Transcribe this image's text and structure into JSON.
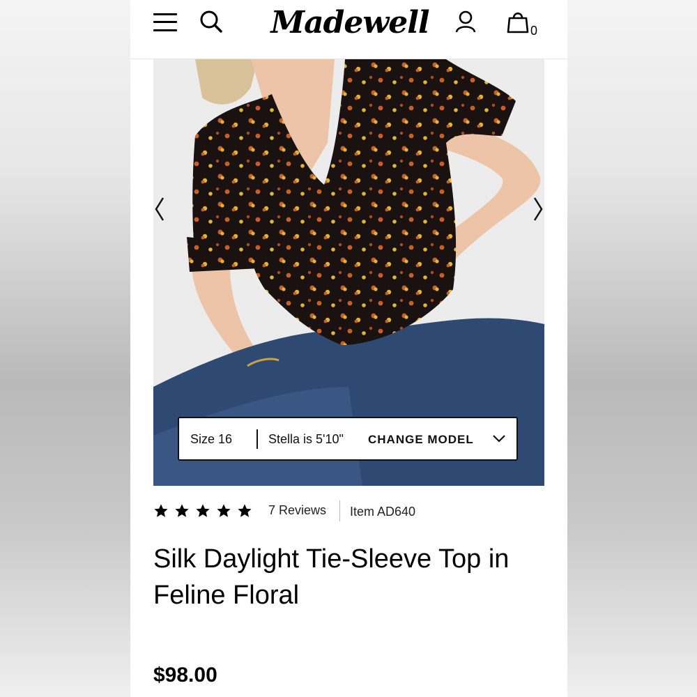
{
  "header": {
    "brand": "Madewell",
    "bag_count": "0"
  },
  "icons": [
    "menu-icon",
    "search-icon",
    "account-icon",
    "bag-icon",
    "chevron-left-icon",
    "chevron-right-icon",
    "chevron-down-icon",
    "star-icon"
  ],
  "model_info": {
    "size": "Size 16",
    "model": "Stella is 5'10\"",
    "change": "CHANGE MODEL"
  },
  "rating": {
    "stars": 5,
    "reviews": "7 Reviews",
    "item": "Item AD640"
  },
  "product": {
    "title": "Silk Daylight Tie-Sleeve Top in Feline Floral",
    "price": "$98.00"
  },
  "colors": {
    "text": "#000000",
    "top_fabric": "#1a1210",
    "denim": "#2f4a72",
    "floral_orange": "#c8602a",
    "floral_yellow": "#e3b43c"
  }
}
